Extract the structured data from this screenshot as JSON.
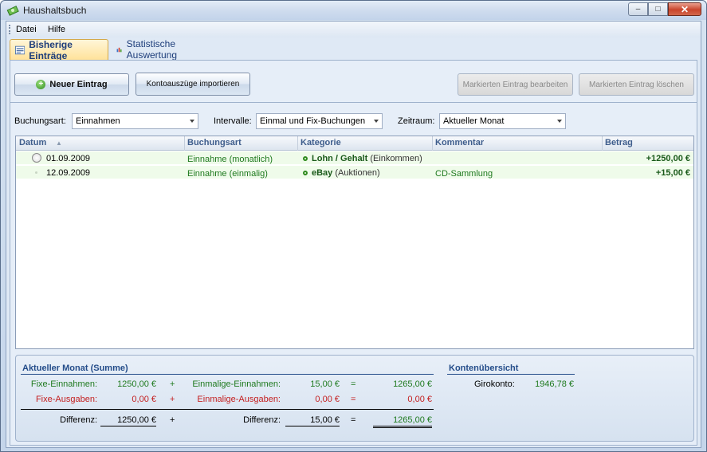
{
  "window": {
    "title": "Haushaltsbuch",
    "min": "–",
    "max": "□",
    "close": "✕"
  },
  "menu": {
    "items": [
      "Datei",
      "Hilfe"
    ]
  },
  "tabs": [
    {
      "label": "Bisherige Einträge"
    },
    {
      "label": "Statistische Auswertung"
    }
  ],
  "toolbar": {
    "new_entry": "Neuer Eintrag",
    "import": "Kontoauszüge importieren",
    "edit": "Markierten Eintrag bearbeiten",
    "delete": "Markierten Eintrag löschen"
  },
  "filters": {
    "buchungsart_label": "Buchungsart:",
    "buchungsart_value": "Einnahmen",
    "intervalle_label": "Intervalle:",
    "intervalle_value": "Einmal und Fix-Buchungen",
    "zeitraum_label": "Zeitraum:",
    "zeitraum_value": "Aktueller Monat"
  },
  "table": {
    "columns": [
      "Datum",
      "Buchungsart",
      "Kategorie",
      "Kommentar",
      "Betrag"
    ],
    "sort_indicator": "▲",
    "rows": [
      {
        "datum": "01.09.2009",
        "buchungsart": "Einnahme (monatlich)",
        "kategorie": "Lohn / Gehalt",
        "kategorie_parent": "(Einkommen)",
        "kommentar": "",
        "betrag": "+1250,00 €"
      },
      {
        "datum": "12.09.2009",
        "buchungsart": "Einnahme (einmalig)",
        "kategorie": "eBay",
        "kategorie_parent": "(Auktionen)",
        "kommentar": "CD-Sammlung",
        "betrag": "+15,00 €"
      }
    ]
  },
  "summary": {
    "title": "Aktueller Monat (Summe)",
    "fix_in_label": "Fixe-Einnahmen:",
    "fix_in": "1250,00 €",
    "fix_out_label": "Fixe-Ausgaben:",
    "fix_out": "0,00 €",
    "diff_label": "Differenz:",
    "diff_fix": "1250,00 €",
    "once_in_label": "Einmalige-Einnahmen:",
    "once_in": "15,00 €",
    "once_out_label": "Einmalige-Ausgaben:",
    "once_out": "0,00 €",
    "diff_once_label": "Differenz:",
    "diff_once": "15,00 €",
    "total_in": "1265,00 €",
    "total_out": "0,00 €",
    "total": "1265,00 €",
    "plus": "+",
    "eq": "="
  },
  "accounts": {
    "title": "Kontenübersicht",
    "giro_label": "Girokonto:",
    "giro_value": "1946,78 €"
  }
}
